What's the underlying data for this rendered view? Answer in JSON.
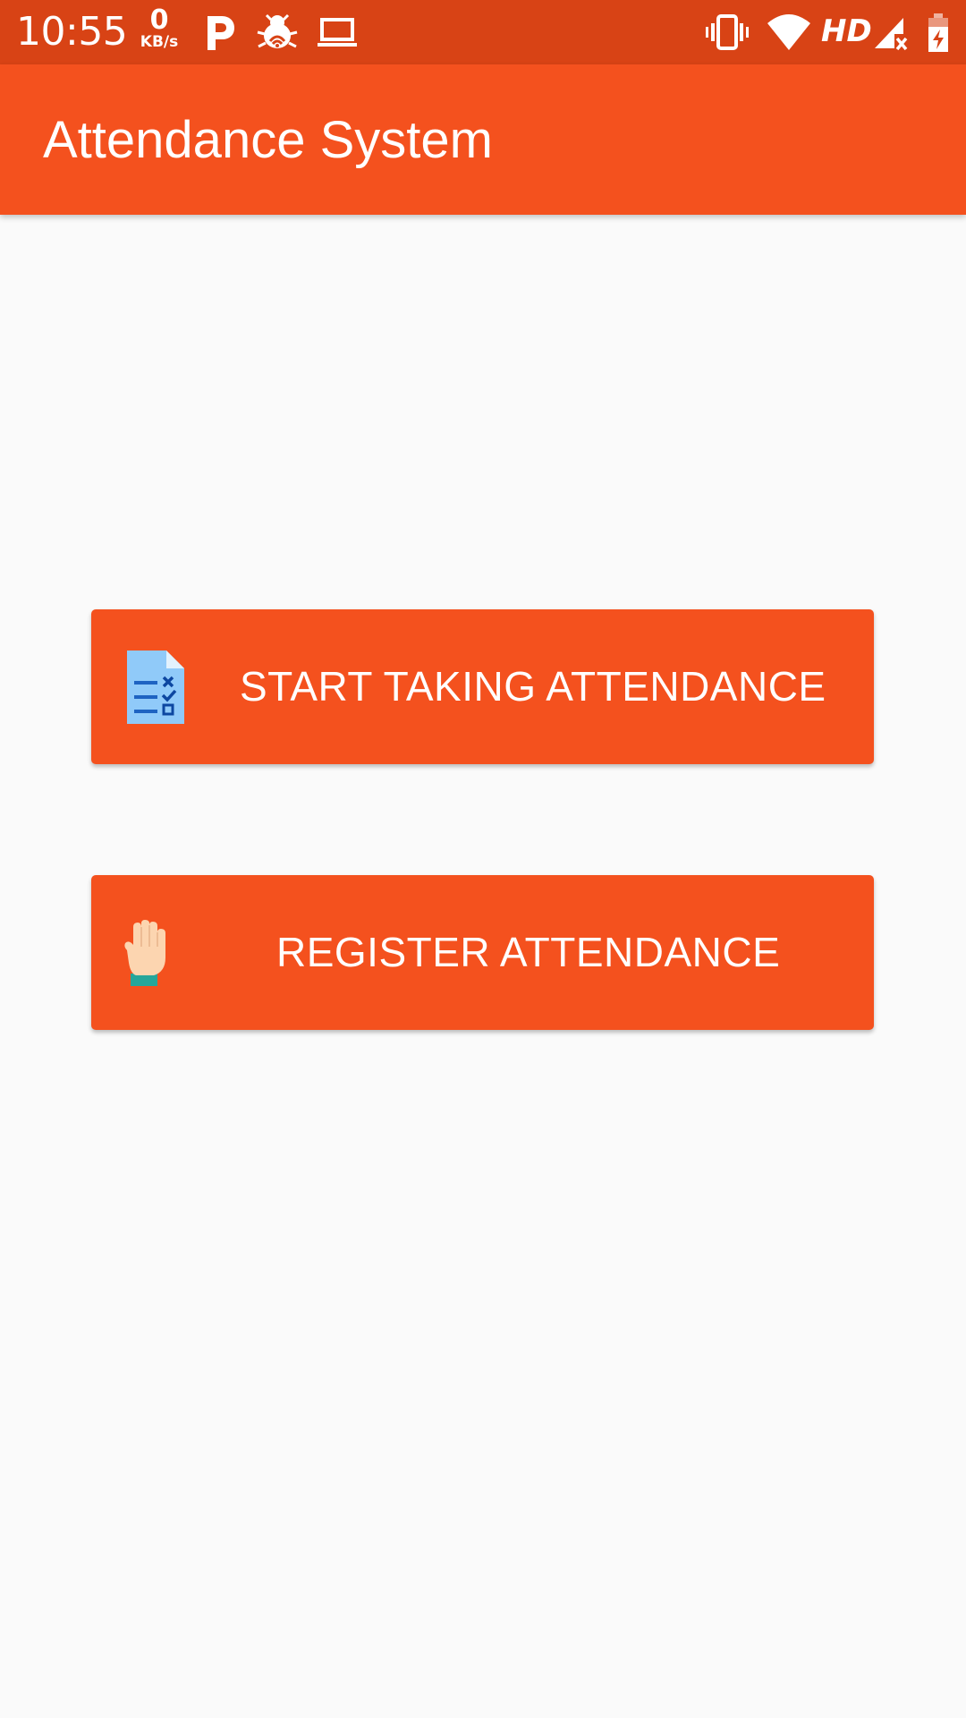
{
  "status_bar": {
    "time": "10:55",
    "net_speed_value": "0",
    "net_speed_unit": "KB/s",
    "network_label": "HD",
    "icons": [
      "parking-app-icon",
      "bug-icon",
      "laptop-icon",
      "vibrate-icon",
      "wifi-icon",
      "signal-no-service-icon",
      "battery-charging-icon"
    ]
  },
  "app_bar": {
    "title": "Attendance System"
  },
  "buttons": {
    "start_label": "START TAKING ATTENDANCE",
    "start_icon": "checklist-document-icon",
    "register_label": "REGISTER ATTENDANCE",
    "register_icon": "raised-hand-icon"
  },
  "colors": {
    "status_bar": "#d84315",
    "app_bar": "#f4511e",
    "button": "#f4511e",
    "background": "#fafafa",
    "text_on_accent": "#ffffff"
  }
}
